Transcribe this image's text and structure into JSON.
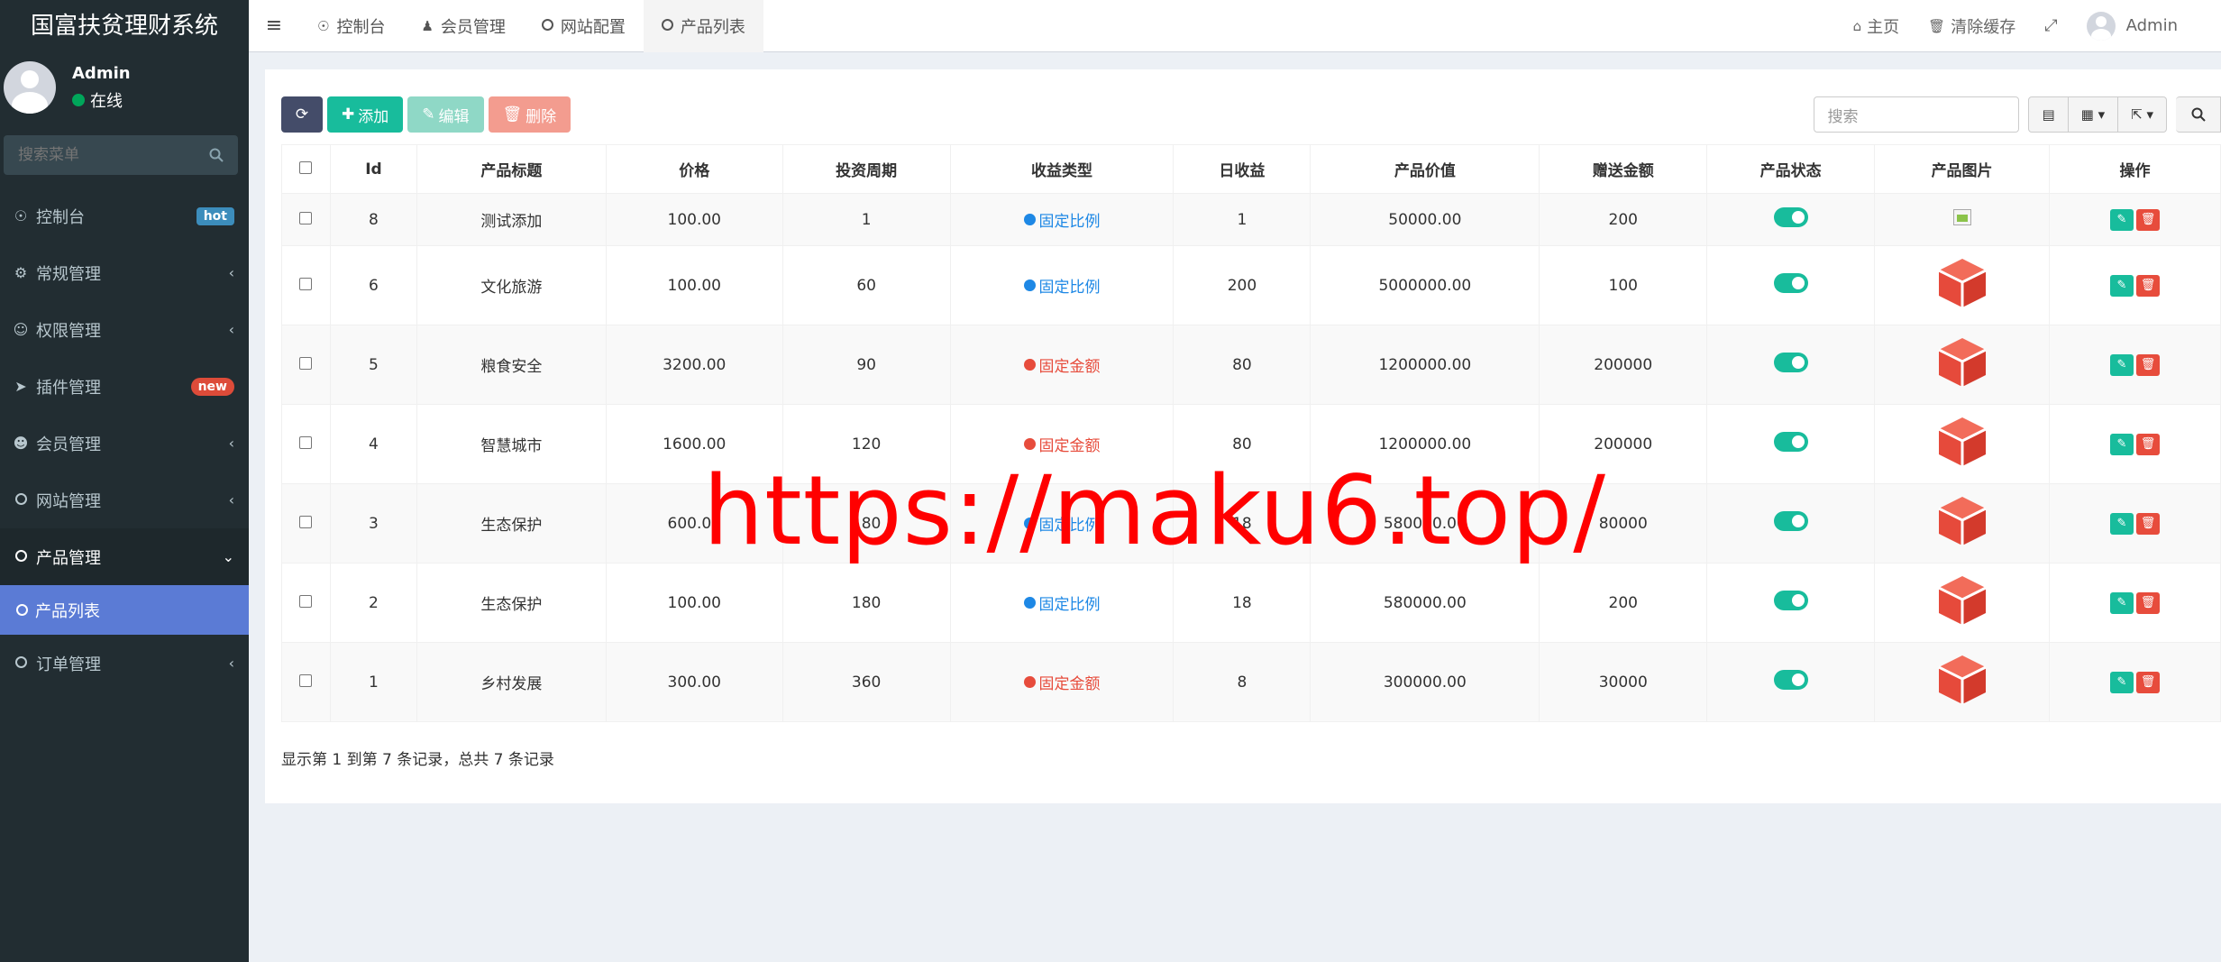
{
  "app": {
    "title": "国富扶贫理财系统"
  },
  "user": {
    "name": "Admin",
    "status": "在线"
  },
  "sidebar": {
    "search_placeholder": "搜索菜单",
    "items": [
      {
        "label": "控制台",
        "icon": "dashboard-icon",
        "badge": "hot"
      },
      {
        "label": "常规管理",
        "icon": "cogs-icon"
      },
      {
        "label": "权限管理",
        "icon": "group-icon"
      },
      {
        "label": "插件管理",
        "icon": "rocket-icon",
        "badge": "new"
      },
      {
        "label": "会员管理",
        "icon": "user-circle-icon"
      },
      {
        "label": "网站管理",
        "icon": "circle-icon"
      },
      {
        "label": "产品管理",
        "icon": "circle-icon",
        "active": true
      },
      {
        "label": "订单管理",
        "icon": "circle-icon"
      }
    ],
    "submenu": {
      "label": "产品列表"
    }
  },
  "navbar": {
    "tabs": [
      {
        "label": "控制台",
        "icon": "dashboard-icon"
      },
      {
        "label": "会员管理",
        "icon": "user-icon"
      },
      {
        "label": "网站配置",
        "icon": "circle-icon"
      },
      {
        "label": "产品列表",
        "icon": "circle-icon",
        "active": true
      }
    ],
    "home": "主页",
    "clear_cache": "清除缓存",
    "user": "Admin"
  },
  "toolbar": {
    "add": "添加",
    "edit": "编辑",
    "delete": "删除",
    "search_placeholder": "搜索"
  },
  "table": {
    "columns": [
      "Id",
      "产品标题",
      "价格",
      "投资周期",
      "收益类型",
      "日收益",
      "产品价值",
      "赠送金额",
      "产品状态",
      "产品图片",
      "操作"
    ],
    "rows": [
      {
        "id": "8",
        "title": "测试添加",
        "price": "100.00",
        "period": "1",
        "type": "固定比例",
        "type_color": "#1e88e5",
        "daily": "1",
        "value": "50000.00",
        "bonus": "200",
        "image": "broken"
      },
      {
        "id": "6",
        "title": "文化旅游",
        "price": "100.00",
        "period": "60",
        "type": "固定比例",
        "type_color": "#1e88e5",
        "daily": "200",
        "value": "5000000.00",
        "bonus": "100",
        "image": "cube"
      },
      {
        "id": "5",
        "title": "粮食安全",
        "price": "3200.00",
        "period": "90",
        "type": "固定金额",
        "type_color": "#e74c3c",
        "daily": "80",
        "value": "1200000.00",
        "bonus": "200000",
        "image": "cube"
      },
      {
        "id": "4",
        "title": "智慧城市",
        "price": "1600.00",
        "period": "120",
        "type": "固定金额",
        "type_color": "#e74c3c",
        "daily": "80",
        "value": "1200000.00",
        "bonus": "200000",
        "image": "cube"
      },
      {
        "id": "3",
        "title": "生态保护",
        "price": "600.00",
        "period": "180",
        "type": "固定比例",
        "type_color": "#1e88e5",
        "daily": "18",
        "value": "580000.00",
        "bonus": "80000",
        "image": "cube"
      },
      {
        "id": "2",
        "title": "生态保护",
        "price": "100.00",
        "period": "180",
        "type": "固定比例",
        "type_color": "#1e88e5",
        "daily": "18",
        "value": "580000.00",
        "bonus": "200",
        "image": "cube"
      },
      {
        "id": "1",
        "title": "乡村发展",
        "price": "300.00",
        "period": "360",
        "type": "固定金额",
        "type_color": "#e74c3c",
        "daily": "8",
        "value": "300000.00",
        "bonus": "30000",
        "image": "cube"
      }
    ]
  },
  "pagination": {
    "info": "显示第 1 到第 7 条记录，总共 7 条记录"
  },
  "watermark": "https://maku6.top/"
}
